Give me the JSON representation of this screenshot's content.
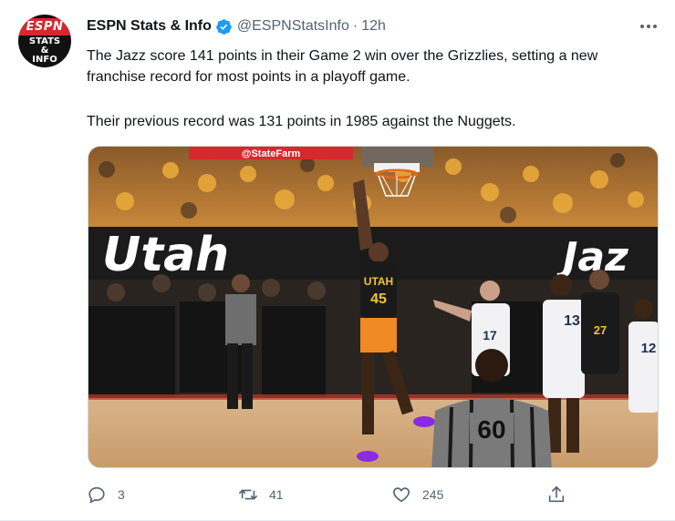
{
  "author": {
    "display_name": "ESPN Stats & Info",
    "handle": "@ESPNStatsInfo",
    "separator": "·",
    "time": "12h",
    "avatar_text_top": "ESPN",
    "avatar_text_mid": "STATS",
    "avatar_text_amp": "&",
    "avatar_text_bottom": "INFO"
  },
  "tweet": {
    "line1": "The Jazz score 141 points in their Game 2 win over the Grizzlies, setting a new franchise record for most points in a playoff game.",
    "line2": "Their previous record was 131 points in 1985 against the Nuggets."
  },
  "media": {
    "court_banner_left": "Utah",
    "court_banner_right": "Jaz",
    "top_banner": "@StateFarm",
    "jersey_main_team": "UTAH",
    "jersey_main_number": "45",
    "jersey_17": "17",
    "jersey_13": "13",
    "jersey_27": "27",
    "jersey_12": "12",
    "ref_number": "60"
  },
  "actions": {
    "replies": "3",
    "retweets": "41",
    "likes": "245"
  },
  "icons": {
    "verified": "verified-badge-icon",
    "more": "more-options-icon",
    "reply": "reply-icon",
    "retweet": "retweet-icon",
    "like": "heart-icon",
    "share": "share-icon"
  },
  "colors": {
    "verified_blue": "#1d9bf0",
    "secondary_text": "#536471",
    "espn_red": "#d7282f"
  }
}
